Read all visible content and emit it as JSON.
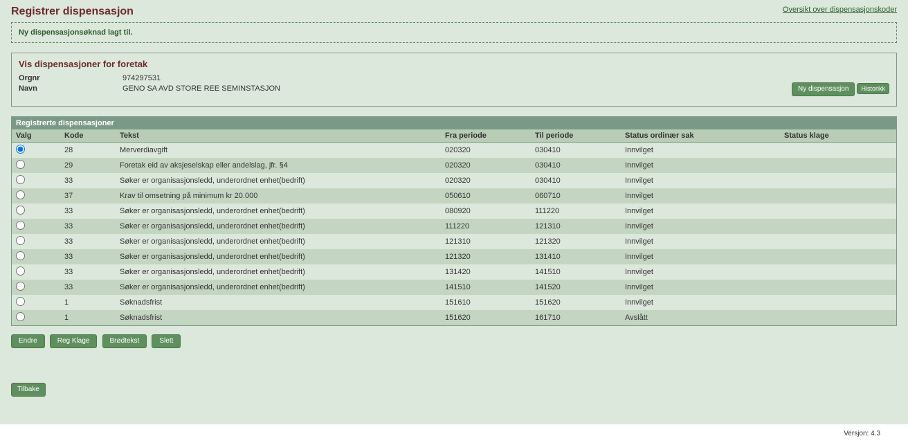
{
  "header": {
    "title": "Registrer dispensasjon",
    "codes_link": "Oversikt over dispensasjonskoder"
  },
  "banner": {
    "text": "Ny dispensasjonsøknad lagt til."
  },
  "info_panel": {
    "heading": "Vis dispensasjoner for foretak",
    "orgnr_label": "Orgnr",
    "orgnr_value": "974297531",
    "navn_label": "Navn",
    "navn_value": "GENO SA AVD STORE REE SEMINSTASJON",
    "btn_new": "Ny dispensasjon",
    "btn_history": "Historikk"
  },
  "table": {
    "title": "Registrerte dispensasjoner",
    "headers": {
      "valg": "Valg",
      "kode": "Kode",
      "tekst": "Tekst",
      "fra": "Fra periode",
      "til": "Til periode",
      "status": "Status ordinær sak",
      "klage": "Status klage"
    },
    "rows": [
      {
        "selected": true,
        "kode": "28",
        "tekst": "Merverdiavgift",
        "fra": "020320",
        "til": "030410",
        "status": "Innvilget",
        "klage": ""
      },
      {
        "selected": false,
        "kode": "29",
        "tekst": "Foretak eid av aksjeselskap eller andelslag, jfr. §4",
        "fra": "020320",
        "til": "030410",
        "status": "Innvilget",
        "klage": ""
      },
      {
        "selected": false,
        "kode": "33",
        "tekst": "Søker er organisasjonsledd, underordnet enhet(bedrift)",
        "fra": "020320",
        "til": "030410",
        "status": "Innvilget",
        "klage": ""
      },
      {
        "selected": false,
        "kode": "37",
        "tekst": "Krav til omsetning på minimum kr 20.000",
        "fra": "050610",
        "til": "060710",
        "status": "Innvilget",
        "klage": ""
      },
      {
        "selected": false,
        "kode": "33",
        "tekst": "Søker er organisasjonsledd, underordnet enhet(bedrift)",
        "fra": "080920",
        "til": "111220",
        "status": "Innvilget",
        "klage": ""
      },
      {
        "selected": false,
        "kode": "33",
        "tekst": "Søker er organisasjonsledd, underordnet enhet(bedrift)",
        "fra": "111220",
        "til": "121310",
        "status": "Innvilget",
        "klage": ""
      },
      {
        "selected": false,
        "kode": "33",
        "tekst": "Søker er organisasjonsledd, underordnet enhet(bedrift)",
        "fra": "121310",
        "til": "121320",
        "status": "Innvilget",
        "klage": ""
      },
      {
        "selected": false,
        "kode": "33",
        "tekst": "Søker er organisasjonsledd, underordnet enhet(bedrift)",
        "fra": "121320",
        "til": "131410",
        "status": "Innvilget",
        "klage": ""
      },
      {
        "selected": false,
        "kode": "33",
        "tekst": "Søker er organisasjonsledd, underordnet enhet(bedrift)",
        "fra": "131420",
        "til": "141510",
        "status": "Innvilget",
        "klage": ""
      },
      {
        "selected": false,
        "kode": "33",
        "tekst": "Søker er organisasjonsledd, underordnet enhet(bedrift)",
        "fra": "141510",
        "til": "141520",
        "status": "Innvilget",
        "klage": ""
      },
      {
        "selected": false,
        "kode": "1",
        "tekst": "Søknadsfrist",
        "fra": "151610",
        "til": "151620",
        "status": "Innvilget",
        "klage": ""
      },
      {
        "selected": false,
        "kode": "1",
        "tekst": "Søknadsfrist",
        "fra": "151620",
        "til": "161710",
        "status": "Avslått",
        "klage": ""
      }
    ]
  },
  "actions": {
    "endre": "Endre",
    "reg_klage": "Reg Klage",
    "brodtekst": "Brødtekst",
    "slett": "Slett",
    "tilbake": "Tilbake"
  },
  "footer": {
    "version": "Versjon: 4.3"
  }
}
